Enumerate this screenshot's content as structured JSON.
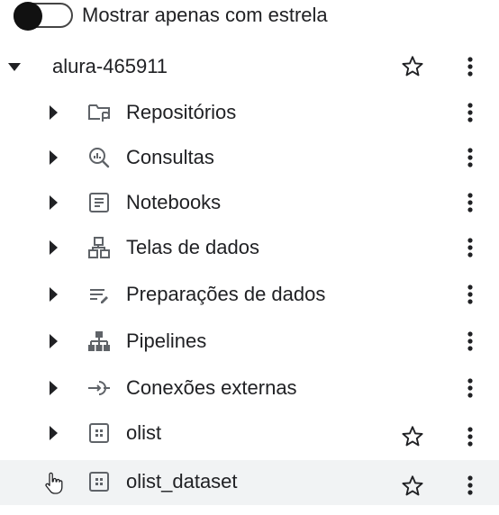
{
  "filter": {
    "label": "Mostrar apenas com estrela",
    "enabled": false
  },
  "project": {
    "name": "alura-465911",
    "starred": false
  },
  "children": [
    {
      "label": "Repositórios",
      "icon": "repository-icon"
    },
    {
      "label": "Consultas",
      "icon": "query-icon"
    },
    {
      "label": "Notebooks",
      "icon": "notebook-icon"
    },
    {
      "label": "Telas de dados",
      "icon": "data-canvas-icon"
    },
    {
      "label": "Preparações de dados",
      "icon": "data-preparation-icon"
    },
    {
      "label": "Pipelines",
      "icon": "pipeline-icon"
    },
    {
      "label": "Conexões externas",
      "icon": "external-connection-icon"
    },
    {
      "label": "olist",
      "icon": "dataset-icon",
      "starred": false
    },
    {
      "label": "olist_dataset",
      "icon": "dataset-icon",
      "starred": false,
      "hovered": true
    }
  ]
}
